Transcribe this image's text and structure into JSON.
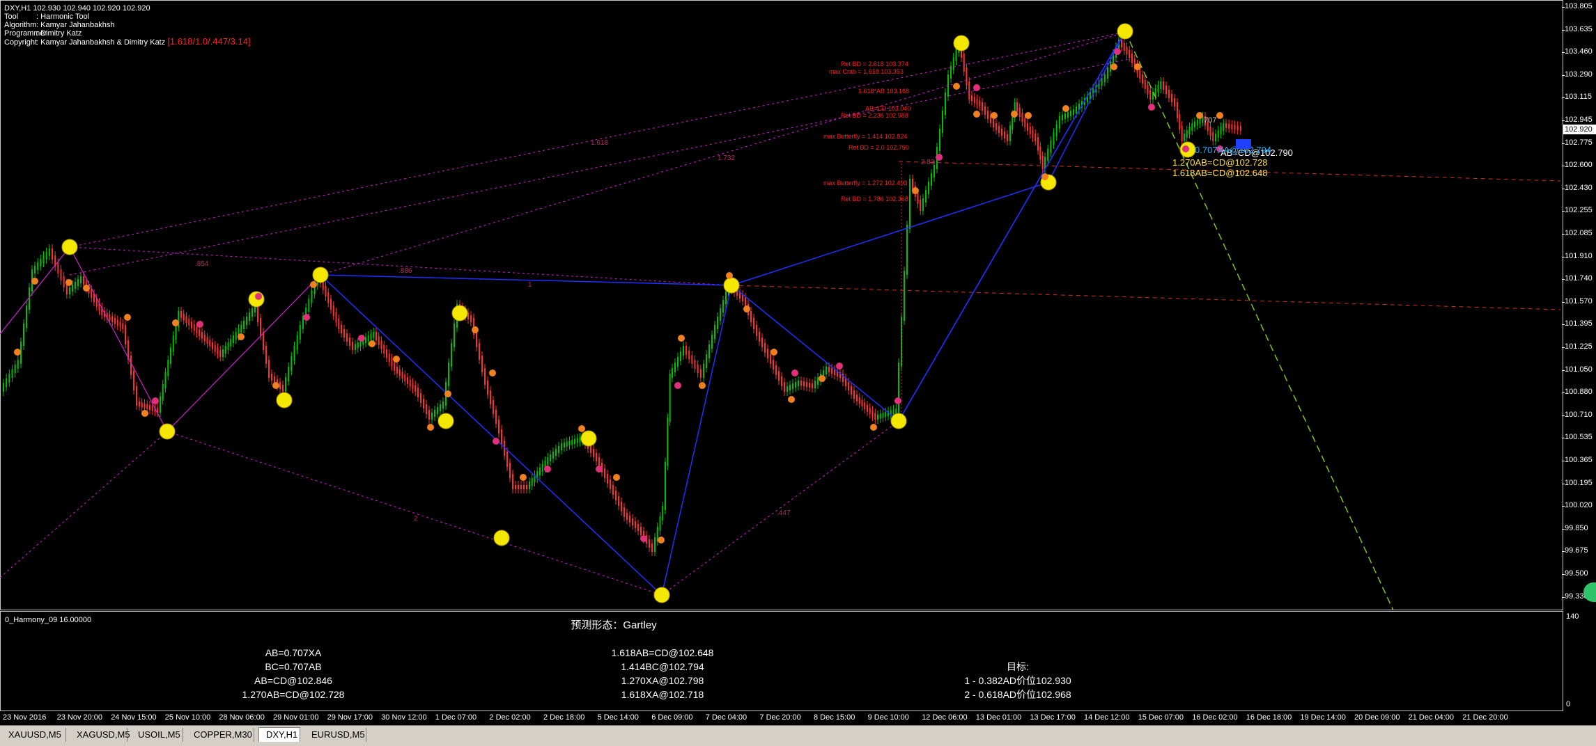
{
  "window": {
    "symbol_line": "DXY,H1  102.930 102.940 102.920 102.920",
    "tool_label": "Tool",
    "tool_value": ": Harmonic Tool",
    "algorithm_label": "Algorithm",
    "algorithm_value": ": Kamyar Jahanbakhsh",
    "programmer_label": "Programmer",
    "programmer_value": ": Dimitry Katz",
    "copyright_label": "Copyright",
    "copyright_value": ": Kamyar Jahanbakhsh & Dimitry Katz",
    "pattern_ratio": "[1.618/1.0/.447/3.14]"
  },
  "price_axis": {
    "ticks": [
      "103.805",
      "103.635",
      "103.460",
      "103.290",
      "103.115",
      "102.945",
      "102.775",
      "102.600",
      "102.430",
      "102.255",
      "102.085",
      "101.910",
      "101.740",
      "101.570",
      "101.395",
      "101.225",
      "101.050",
      "100.880",
      "100.710",
      "100.535",
      "100.365",
      "100.195",
      "100.020",
      "99.850",
      "99.675",
      "99.500",
      "99.330"
    ],
    "current_price": "102.920"
  },
  "chart_labels": {
    "ratio_1618": "1.618",
    "ratio_1732": "1.732",
    "ratio_854": ".854",
    "ratio_886": ".886",
    "ratio_1": "1",
    "ratio_2": "2",
    "ratio_447": ".447",
    "ratio_283": "2.83",
    "fib_levels": [
      "Ret BD = 2.618  103.374",
      "max Crab = 1.618  103.353",
      "1.618*AB  103.168",
      "AB=CD  103.040",
      "Ret BD = 2.236  102.988",
      "max Butterfly = 1.414  102.824",
      "Ret BD = 2.0  102.750",
      "max Butterfly = 1.272  102.493",
      "Ret BD = 1.786  102.368"
    ],
    "proj_1": "1.270AB=CD@102.728",
    "proj_2": "1.618AB=CD@102.648",
    "proj_abcd": "AB=CD@102.790",
    "proj_bc": "1.414BC@102.794",
    "proj_707": ".707",
    "proj_cyan": "0.707XA@102.794"
  },
  "indicator": {
    "title": "0_Harmony_09 16.00000",
    "axis_top": "140",
    "axis_bottom": "0",
    "pattern_title": "预测形态：Gartley",
    "col1": [
      "AB=0.707XA",
      "BC=0.707AB",
      "AB=CD@102.846",
      "1.270AB=CD@102.728"
    ],
    "col2": [
      "1.618AB=CD@102.648",
      "1.414BC@102.794",
      "1.270XA@102.798",
      "1.618XA@102.718"
    ],
    "target_label": "目标:",
    "targets": [
      "1 - 0.382AD价位102.930",
      "2 - 0.618AD价位102.968"
    ]
  },
  "time_axis": [
    "23 Nov 2016",
    "23 Nov 20:00",
    "24 Nov 15:00",
    "25 Nov 10:00",
    "28 Nov 06:00",
    "29 Nov 01:00",
    "29 Nov 17:00",
    "30 Nov 12:00",
    "1 Dec 07:00",
    "2 Dec 02:00",
    "2 Dec 18:00",
    "5 Dec 14:00",
    "6 Dec 09:00",
    "7 Dec 04:00",
    "7 Dec 20:00",
    "8 Dec 15:00",
    "9 Dec 10:00",
    "12 Dec 06:00",
    "13 Dec 01:00",
    "13 Dec 17:00",
    "14 Dec 12:00",
    "15 Dec 07:00",
    "16 Dec 02:00",
    "16 Dec 18:00",
    "19 Dec 14:00",
    "20 Dec 09:00",
    "21 Dec 04:00",
    "21 Dec 20:00"
  ],
  "tabs": [
    "XAUUSD,M5",
    "XAGUSD,M5",
    "USOIL,M5",
    "COPPER,M30",
    "DXY,H1",
    "EURUSD,M5"
  ],
  "active_tab": "DXY,H1",
  "colors": {
    "bull": "#00c000",
    "bear": "#ff3030",
    "pattern": "#2030ff",
    "magenta": "#d020d0",
    "marker": "#f5e800",
    "fib_red": "#ff2020",
    "proj_yellow": "#ffe040",
    "cyan": "#20b0ff"
  }
}
